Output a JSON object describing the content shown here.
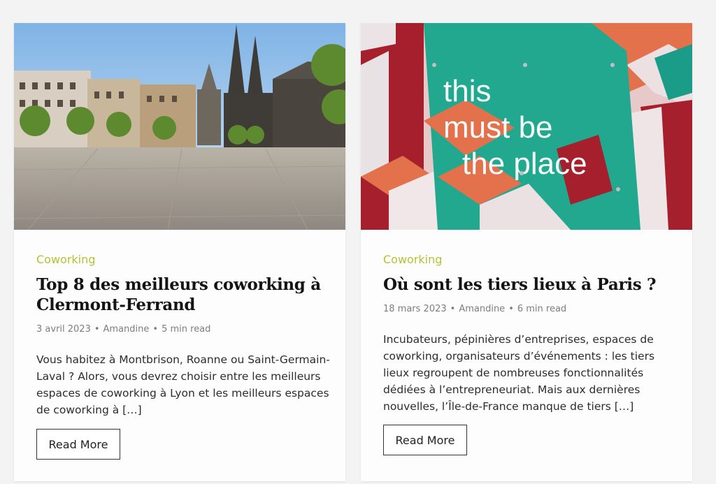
{
  "posts": [
    {
      "category": "Coworking",
      "title": "Top 8 des meilleurs coworking à Clermont-Ferrand",
      "date": "3 avril 2023",
      "author": "Amandine",
      "read_time": "5 min read",
      "separator": "•",
      "excerpt": "Vous habitez à Montbrison, Roanne ou Saint-Germain-Laval ? Alors, vous devrez choisir entre les meilleurs espaces de coworking à Lyon et les meilleurs espaces de coworking à […]",
      "button_label": "Read More",
      "image": "clermont-ferrand-square-cathedral-photo"
    },
    {
      "category": "Coworking",
      "title": "Où sont les tiers lieux à Paris ?",
      "date": "18 mars 2023",
      "author": "Amandine",
      "read_time": "6 min read",
      "separator": "•",
      "excerpt": "Incubateurs, pépinières d’entreprises, espaces de coworking, organisateurs d’événements : les tiers lieux regroupent de nombreuses fonctionnalités dédiées à l’entrepreneuriat. Mais aux dernières nouvelles, l’Île-de-France manque de tiers […]",
      "button_label": "Read More",
      "image": "neon-sign-photo",
      "image_text": [
        "this",
        "must be",
        "the place"
      ]
    }
  ],
  "colors": {
    "accent": "#b5c232",
    "title": "#141414",
    "meta": "#7d7d7d",
    "text": "#2c2c2c",
    "background": "#f3f3f3"
  }
}
